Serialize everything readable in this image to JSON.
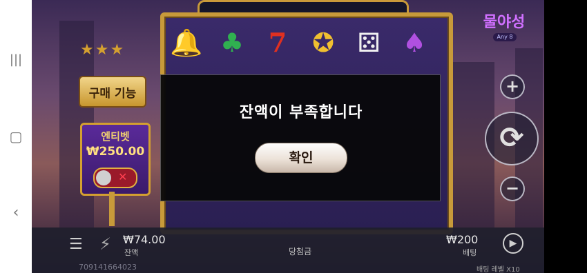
{
  "game": {
    "buy_feature_label": "구매 기능",
    "ante_bet": {
      "title": "엔티벳",
      "amount": "₩250.00",
      "enabled": false
    },
    "logo": {
      "title": "물야성",
      "subtitle": "Any 8"
    },
    "reel_symbols": [
      "bell",
      "club",
      "seven",
      "star-coin",
      "dice",
      "spade"
    ]
  },
  "dialog": {
    "message": "잔액이 부족합니다",
    "confirm_label": "확인"
  },
  "bottom_bar": {
    "balance_value": "₩74.00",
    "balance_label": "잔액",
    "win_label": "당첨금",
    "bet_value": "₩200",
    "bet_label": "배팅",
    "round_id": "709141664023",
    "bet_level": "배팅 레벨  X10"
  },
  "colors": {
    "frame_gold": "#c89a3a",
    "ante_purple": "#5a2a9a",
    "toggle_red": "#9a1a2a"
  }
}
